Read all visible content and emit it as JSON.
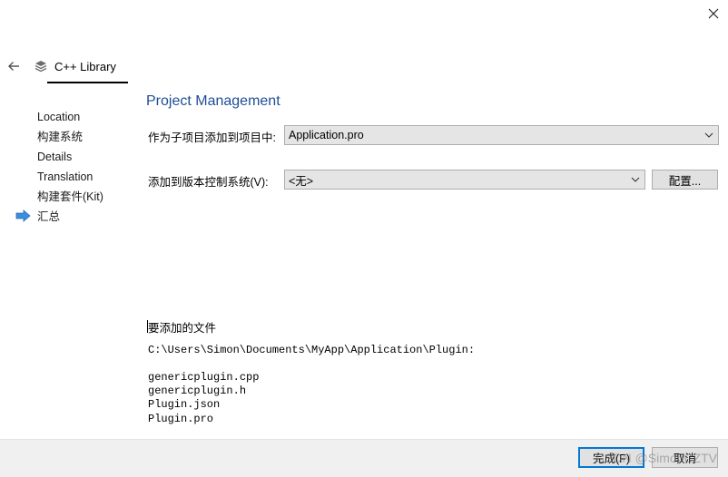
{
  "window": {
    "close_icon": "close-icon"
  },
  "header": {
    "back_icon": "back-arrow-icon",
    "title_icon": "library-icon",
    "title": "C++ Library"
  },
  "sidebar": {
    "items": [
      {
        "label": "Location"
      },
      {
        "label": "构建系统"
      },
      {
        "label": "Details"
      },
      {
        "label": "Translation"
      },
      {
        "label": "构建套件(Kit)"
      },
      {
        "label": "汇总",
        "current": true
      }
    ],
    "current_marker_icon": "current-step-arrow-icon"
  },
  "main": {
    "title": "Project Management",
    "add_to_project": {
      "label": "作为子项目添加到项目中:",
      "value": "Application.pro"
    },
    "version_control": {
      "label": "添加到版本控制系统(V):",
      "value": "<无>",
      "configure_label": "配置..."
    },
    "files": {
      "heading": "要添加的文件",
      "directory": "C:\\Users\\Simon\\Documents\\MyApp\\Application\\Plugin:",
      "list": [
        "genericplugin.cpp",
        "genericplugin.h",
        "Plugin.json",
        "Plugin.pro"
      ]
    }
  },
  "footer": {
    "finish_label": "完成(F)",
    "cancel_label": "取消"
  },
  "watermark": "CSDN @SimonCZTV",
  "colors": {
    "title": "#1f4e96",
    "arrow": "#3c8ddc",
    "focus": "#0078d7"
  }
}
